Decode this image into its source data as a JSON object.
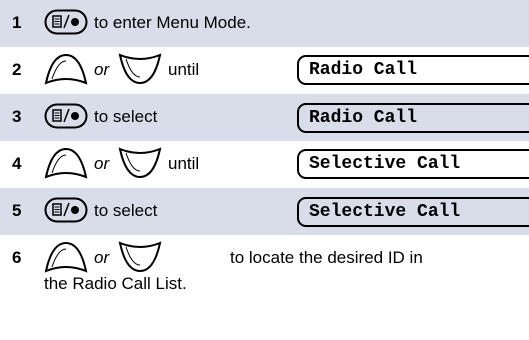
{
  "steps": [
    {
      "number": "1",
      "icon": "menu-select-button-icon",
      "text": "to  enter Menu Mode."
    },
    {
      "number": "2",
      "icons": [
        "scroll-up-button-icon",
        "scroll-down-button-icon"
      ],
      "or": "or",
      "text": "until",
      "display": "Radio Call"
    },
    {
      "number": "3",
      "icon": "menu-select-button-icon",
      "text": "to select",
      "display": "Radio Call"
    },
    {
      "number": "4",
      "icons": [
        "scroll-up-button-icon",
        "scroll-down-button-icon"
      ],
      "or": "or",
      "text": "until",
      "display": "Selective Call"
    },
    {
      "number": "5",
      "icon": "menu-select-button-icon",
      "text": "to select",
      "display": "Selective Call"
    },
    {
      "number": "6",
      "icons": [
        "scroll-up-button-icon",
        "scroll-down-button-icon"
      ],
      "or": "or",
      "text_line1": "to locate the desired ID in",
      "text_line2": "the Radio Call List."
    }
  ],
  "colors": {
    "row_shade": "#d9ddea",
    "text": "#000000"
  }
}
